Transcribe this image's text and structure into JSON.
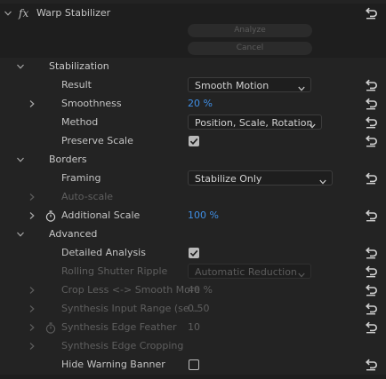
{
  "effect": {
    "fx_label": "fx",
    "name": "Warp Stabilizer",
    "analyze_label": "Analyze",
    "cancel_label": "Cancel"
  },
  "stabilization": {
    "heading": "Stabilization",
    "result": {
      "label": "Result",
      "value": "Smooth Motion"
    },
    "smoothness": {
      "label": "Smoothness",
      "value": "20 %"
    },
    "method": {
      "label": "Method",
      "value": "Position, Scale, Rotation"
    },
    "preserve_scale": {
      "label": "Preserve Scale",
      "checked": true
    }
  },
  "borders": {
    "heading": "Borders",
    "framing": {
      "label": "Framing",
      "value": "Stabilize Only"
    },
    "auto_scale": {
      "label": "Auto-scale"
    },
    "additional_scale": {
      "label": "Additional Scale",
      "value": "100 %"
    }
  },
  "advanced": {
    "heading": "Advanced",
    "detailed_analysis": {
      "label": "Detailed Analysis",
      "checked": true
    },
    "rolling_shutter": {
      "label": "Rolling Shutter Ripple",
      "value": "Automatic Reduction"
    },
    "crop_less": {
      "label": "Crop Less <-> Smooth More",
      "value": "40 %"
    },
    "synthesis_input": {
      "label": "Synthesis Input Range (se...",
      "value": "0.50"
    },
    "synthesis_feather": {
      "label": "Synthesis Edge Feather",
      "value": "10"
    },
    "synthesis_cropping": {
      "label": "Synthesis Edge Cropping"
    },
    "hide_warning": {
      "label": "Hide Warning Banner",
      "checked": false
    }
  },
  "colors": {
    "panel_bg": "#1e1e1e",
    "row_shade": "#232323",
    "text": "#c4c4c4",
    "value_blue": "#3f8fe6",
    "disabled": "#5f5f5f"
  },
  "icons": {
    "expand": "chevron-right-icon",
    "collapse": "chevron-down-icon",
    "reset": "reset-parameter-icon",
    "keyframe": "stopwatch-icon",
    "checkmark": "checkmark-icon",
    "dropdown": "dropdown-arrow-icon"
  }
}
